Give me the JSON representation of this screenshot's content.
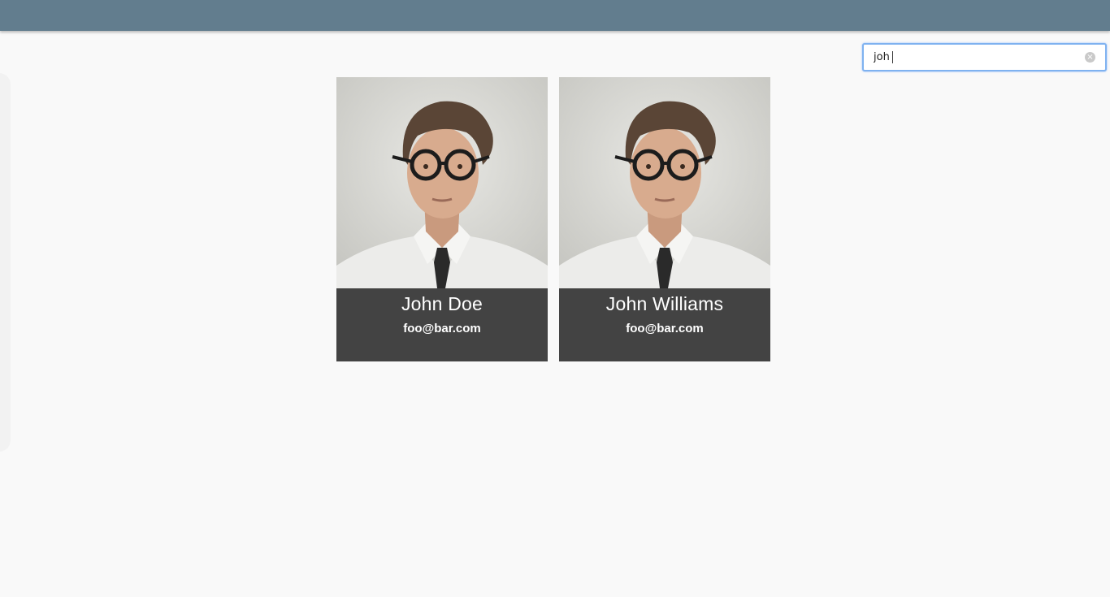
{
  "search": {
    "value": "joh",
    "clear_icon": "clear-circle-icon",
    "clear_glyph": "×"
  },
  "colors": {
    "top_bar": "#627d8e",
    "card_footer": "#434343",
    "focus_ring": "#7fb2f0"
  },
  "contacts": [
    {
      "name": "John Doe",
      "email": "foo@bar.com"
    },
    {
      "name": "John Williams",
      "email": "foo@bar.com"
    }
  ]
}
